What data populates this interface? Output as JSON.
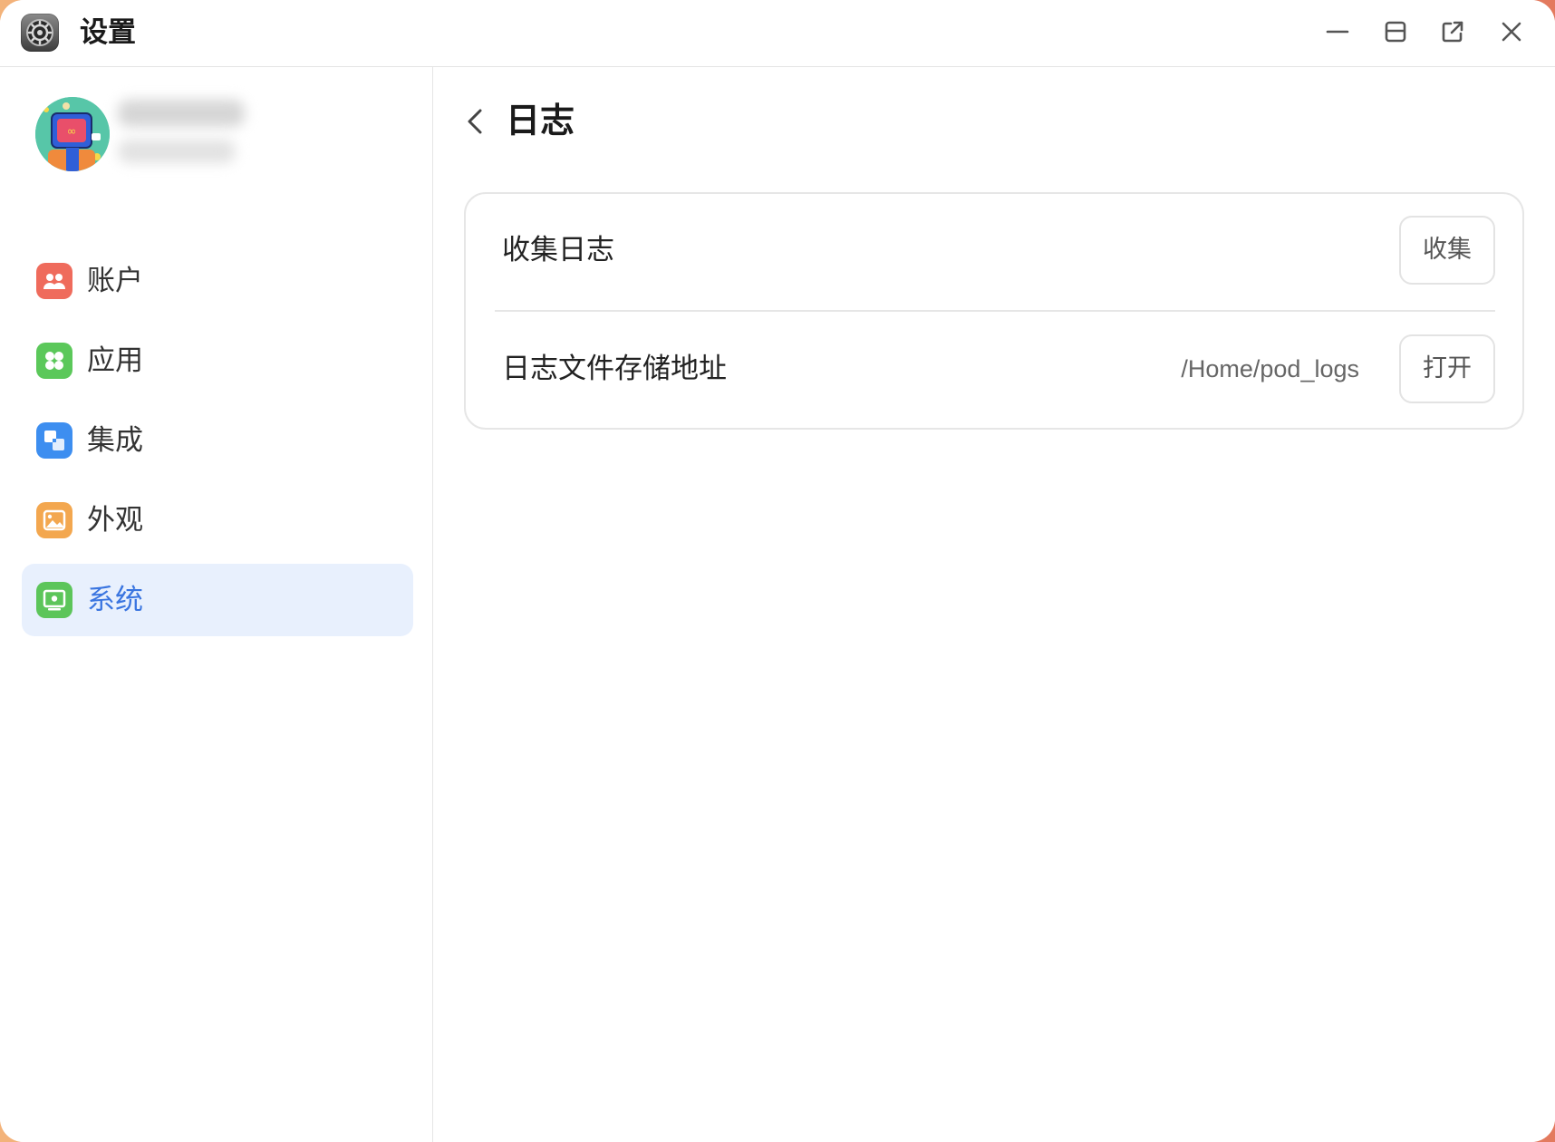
{
  "window": {
    "title": "设置",
    "app_icon": "settings-gear-icon",
    "controls": {
      "minimize_icon": "minimize-icon",
      "maximize_icon": "maximize-icon",
      "popout_icon": "popout-icon",
      "close_icon": "close-icon"
    }
  },
  "user": {
    "avatar_icon": "user-avatar",
    "name": "",
    "subtitle": ""
  },
  "sidebar": {
    "items": [
      {
        "label": "账户",
        "icon": "account-icon",
        "color": "#ef6b5c",
        "active": false
      },
      {
        "label": "应用",
        "icon": "apps-icon",
        "color": "#5bc85a",
        "active": false
      },
      {
        "label": "集成",
        "icon": "integration-icon",
        "color": "#3d8ef0",
        "active": false
      },
      {
        "label": "外观",
        "icon": "appearance-icon",
        "color": "#f3a74f",
        "active": false
      },
      {
        "label": "系统",
        "icon": "system-icon",
        "color": "#5cc55a",
        "active": true
      }
    ]
  },
  "page": {
    "title": "日志",
    "back_icon": "chevron-left-icon"
  },
  "log_settings": {
    "collect": {
      "label": "收集日志",
      "button": "收集"
    },
    "storage": {
      "label": "日志文件存储地址",
      "path": "/Home/pod_logs",
      "button": "打开"
    }
  },
  "colors": {
    "accent": "#3a75e0",
    "active_bg": "#e8f0fd"
  }
}
